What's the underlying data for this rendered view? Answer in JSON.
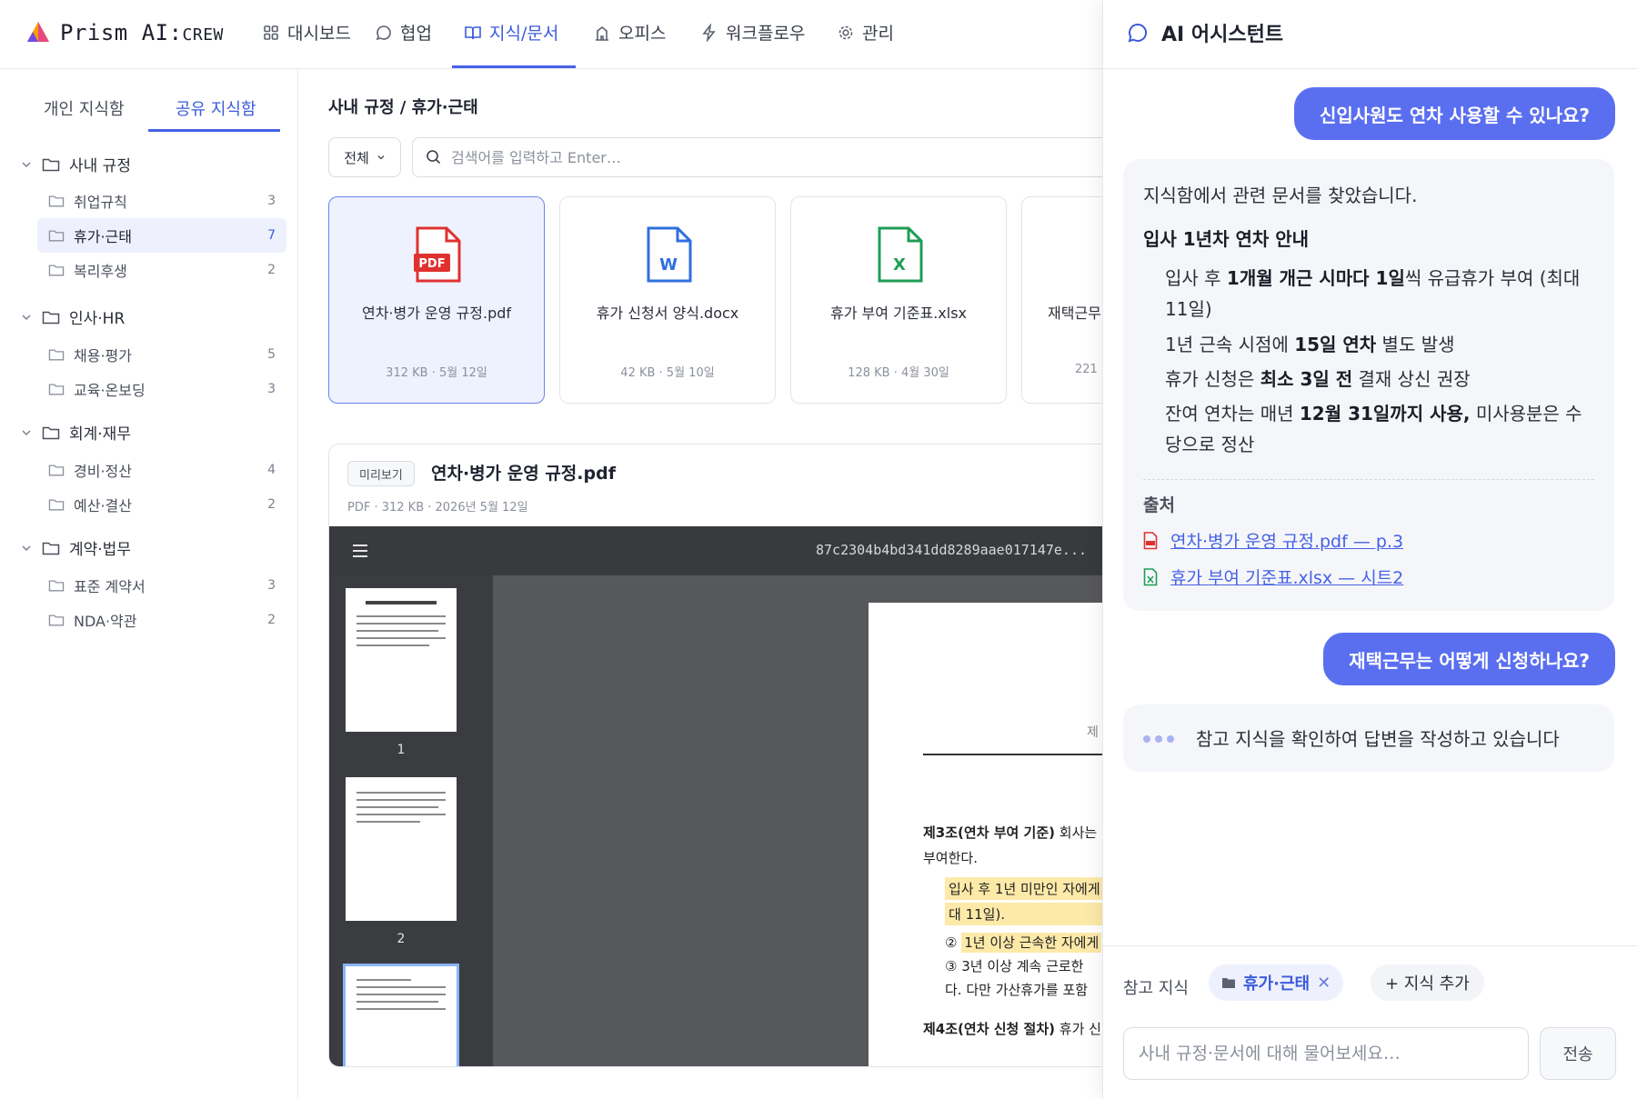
{
  "brand": {
    "name": "Prism AI:",
    "suffix": "CREW"
  },
  "nav": {
    "items": [
      {
        "label": "대시보드"
      },
      {
        "label": "협업"
      },
      {
        "label": "지식/문서"
      },
      {
        "label": "오피스"
      },
      {
        "label": "워크플로우"
      },
      {
        "label": "관리"
      }
    ],
    "active": "지식/문서"
  },
  "sidebar": {
    "tabs": [
      {
        "label": "개인 지식함"
      },
      {
        "label": "공유 지식함"
      }
    ],
    "active_tab": "공유 지식함",
    "groups": [
      {
        "label": "사내 규정",
        "children": [
          {
            "label": "취업규칙",
            "count": "3"
          },
          {
            "label": "휴가·근태",
            "count": "7"
          },
          {
            "label": "복리후생",
            "count": "2"
          }
        ]
      },
      {
        "label": "인사·HR",
        "children": [
          {
            "label": "채용·평가",
            "count": "5"
          },
          {
            "label": "교육·온보딩",
            "count": "3"
          }
        ]
      },
      {
        "label": "회계·재무",
        "children": [
          {
            "label": "경비·정산",
            "count": "4"
          },
          {
            "label": "예산·결산",
            "count": "2"
          }
        ]
      },
      {
        "label": "계약·법무",
        "children": [
          {
            "label": "표준 계약서",
            "count": "3"
          },
          {
            "label": "NDA·약관",
            "count": "2"
          }
        ]
      }
    ],
    "selected": "휴가·근태"
  },
  "main": {
    "breadcrumb": "사내 규정 / 휴가·근태",
    "filter_label": "전체",
    "search_placeholder": "검색어를 입력하고 Enter…",
    "files": [
      {
        "name": "연차·병가 운영 규정.pdf",
        "meta": "312 KB · 5월 12일",
        "type": "pdf",
        "icon_label": "PDF",
        "color": "#e03131"
      },
      {
        "name": "휴가 신청서 양식.docx",
        "meta": "42 KB · 5월 10일",
        "type": "docx",
        "icon_label": "W",
        "color": "#2f6fe0"
      },
      {
        "name": "휴가 부여 기준표.xlsx",
        "meta": "128 KB · 4월 30일",
        "type": "xlsx",
        "icon_label": "X",
        "color": "#1f9d55"
      },
      {
        "name": "재택근무",
        "meta": "221",
        "type": "doc",
        "icon_label": "",
        "color": "#2f6fe0"
      }
    ],
    "preview": {
      "badge": "미리보기",
      "title": "연차·병가 운영 규정.pdf",
      "meta": "PDF · 312 KB · 2026년 5월 12일",
      "hash": "87c2304b4bd341dd8289aae017147e...",
      "thumb_numbers": [
        "1",
        "2"
      ],
      "page": {
        "heading_fragment": "제",
        "art3_title": "제3조(연차 부여 기준)",
        "art3_rest": " 회사는",
        "art3_line2": "부여한다.",
        "item1_line1": "입사 후 1년 미만인 자에게",
        "item1_line2": "대 11일).",
        "item2_num": "②",
        "item2_text": "1년 이상 근속한 자에게",
        "item3": "③ 3년 이상 계속 근로한 ",
        "item3_line2": "다. 다만 가산휴가를 포함",
        "art4_title": "제4조(연차 신청 절차)",
        "art4_rest": " 휴가 신"
      }
    }
  },
  "assistant": {
    "title": "AI 어시스턴트",
    "q1": "신입사원도 연차 사용할 수 있나요?",
    "a1": {
      "intro": "지식함에서 관련 문서를 찾았습니다.",
      "heading": "입사 1년차 연차 안내",
      "l1a": "입사 후 ",
      "l1b": "1개월 개근 시마다 1일",
      "l1c": "씩 유급휴가 부여 (최대",
      "l1d": "11일)",
      "l2a": "1년 근속 시점에 ",
      "l2b": "15일 연차",
      "l2c": " 별도 발생",
      "l3a": "휴가 신청은 ",
      "l3b": "최소 3일 전",
      "l3c": " 결재 상신 권장",
      "l4a": "잔여 연차는 매년 ",
      "l4b": "12월 31일까지 사용,",
      "l4c": " 미사용분은 수",
      "l4d": "당으로 정산",
      "sources_label": "출처",
      "sources": [
        {
          "label": "연차·병가 운영 규정.pdf — p.3",
          "color": "#e03131"
        },
        {
          "label": "휴가 부여 기준표.xlsx — 시트2",
          "color": "#1f9d55"
        }
      ]
    },
    "q2": "재택근무는 어떻게 신청하나요?",
    "typing": "참고 지식을 확인하여 답변을 작성하고 있습니다",
    "ref_label": "참고 지식",
    "ref_chip": "휴가·근태",
    "ref_add": "+ 지식 추가",
    "input_placeholder": "사내 규정·문서에 대해 물어보세요…",
    "send_label": "전송"
  }
}
